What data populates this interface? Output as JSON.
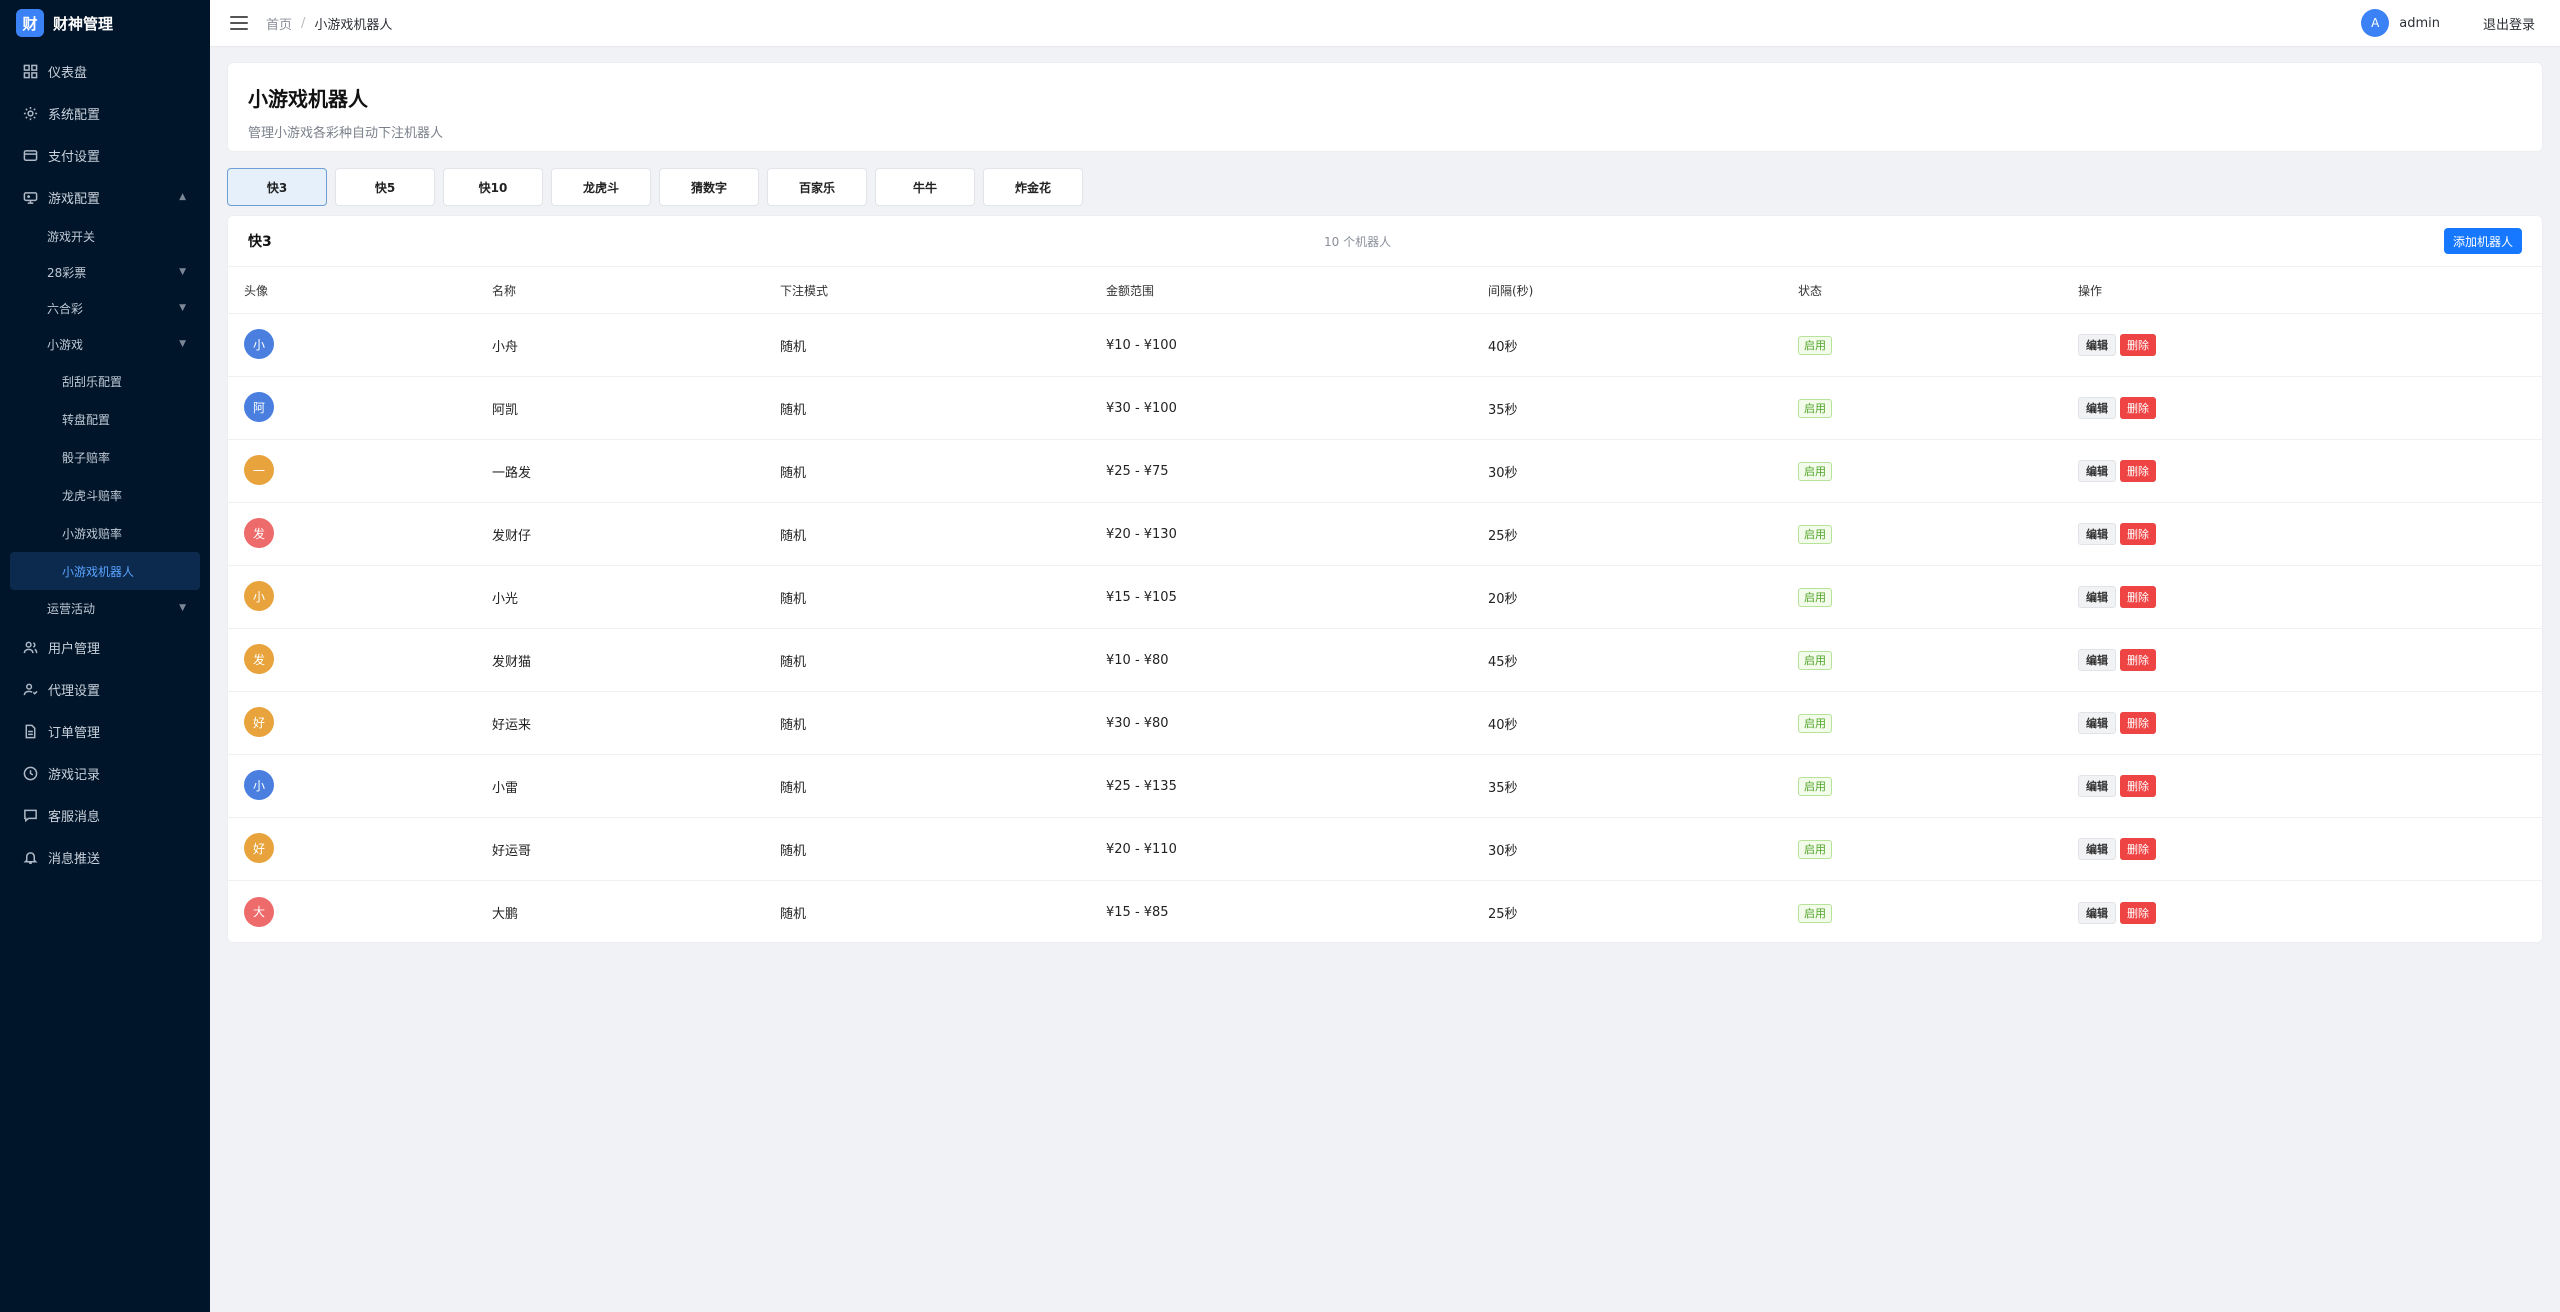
{
  "brand": {
    "logo_char": "财",
    "name": "财神管理"
  },
  "sidebar": {
    "items": [
      {
        "label": "仪表盘",
        "icon": "dashboard-icon"
      },
      {
        "label": "系统配置",
        "icon": "gear-icon"
      },
      {
        "label": "支付设置",
        "icon": "credit-card-icon"
      },
      {
        "label": "游戏配置",
        "icon": "gamepad-icon",
        "arrow": "▲"
      }
    ],
    "game_sub": [
      {
        "label": "游戏开关"
      },
      {
        "label": "28彩票",
        "arrow": "▼"
      },
      {
        "label": "六合彩",
        "arrow": "▼"
      },
      {
        "label": "小游戏",
        "arrow": "▼"
      }
    ],
    "mini_sub": [
      {
        "label": "刮刮乐配置"
      },
      {
        "label": "转盘配置"
      },
      {
        "label": "骰子赔率"
      },
      {
        "label": "龙虎斗赔率"
      },
      {
        "label": "小游戏赔率"
      },
      {
        "label": "小游戏机器人"
      }
    ],
    "promo": {
      "label": "运营活动",
      "arrow": "▼"
    },
    "bottom_items": [
      {
        "label": "用户管理",
        "icon": "users-icon"
      },
      {
        "label": "代理设置",
        "icon": "agent-icon"
      },
      {
        "label": "订单管理",
        "icon": "document-icon"
      },
      {
        "label": "游戏记录",
        "icon": "clock-icon"
      },
      {
        "label": "客服消息",
        "icon": "chat-icon"
      },
      {
        "label": "消息推送",
        "icon": "bell-icon"
      }
    ]
  },
  "header": {
    "breadcrumb_home": "首页",
    "breadcrumb_sep": "/",
    "breadcrumb_current": "小游戏机器人",
    "user_avatar": "A",
    "user_name": "admin",
    "logout": "退出登录"
  },
  "page": {
    "title": "小游戏机器人",
    "subtitle": "管理小游戏各彩种自动下注机器人"
  },
  "tabs": [
    "快3",
    "快5",
    "快10",
    "龙虎斗",
    "猜数字",
    "百家乐",
    "牛牛",
    "炸金花"
  ],
  "table": {
    "title": "快3",
    "count": "10 个机器人",
    "add_button": "添加机器人",
    "columns": [
      "头像",
      "名称",
      "下注模式",
      "金额范围",
      "间隔(秒)",
      "状态",
      "操作"
    ],
    "edit_label": "编辑",
    "delete_label": "删除",
    "rows": [
      {
        "avatar": "小",
        "color": "#4a7fe0",
        "name": "小舟",
        "mode": "随机",
        "range": "¥10 - ¥100",
        "interval": "40秒",
        "status": "启用"
      },
      {
        "avatar": "阿",
        "color": "#4a7fe0",
        "name": "阿凯",
        "mode": "随机",
        "range": "¥30 - ¥100",
        "interval": "35秒",
        "status": "启用"
      },
      {
        "avatar": "一",
        "color": "#e8a33c",
        "name": "一路发",
        "mode": "随机",
        "range": "¥25 - ¥75",
        "interval": "30秒",
        "status": "启用"
      },
      {
        "avatar": "发",
        "color": "#ee6b6b",
        "name": "发财仔",
        "mode": "随机",
        "range": "¥20 - ¥130",
        "interval": "25秒",
        "status": "启用"
      },
      {
        "avatar": "小",
        "color": "#e8a33c",
        "name": "小光",
        "mode": "随机",
        "range": "¥15 - ¥105",
        "interval": "20秒",
        "status": "启用"
      },
      {
        "avatar": "发",
        "color": "#e8a33c",
        "name": "发财猫",
        "mode": "随机",
        "range": "¥10 - ¥80",
        "interval": "45秒",
        "status": "启用"
      },
      {
        "avatar": "好",
        "color": "#e8a33c",
        "name": "好运来",
        "mode": "随机",
        "range": "¥30 - ¥80",
        "interval": "40秒",
        "status": "启用"
      },
      {
        "avatar": "小",
        "color": "#4a7fe0",
        "name": "小雷",
        "mode": "随机",
        "range": "¥25 - ¥135",
        "interval": "35秒",
        "status": "启用"
      },
      {
        "avatar": "好",
        "color": "#e8a33c",
        "name": "好运哥",
        "mode": "随机",
        "range": "¥20 - ¥110",
        "interval": "30秒",
        "status": "启用"
      },
      {
        "avatar": "大",
        "color": "#ee6b6b",
        "name": "大鹏",
        "mode": "随机",
        "range": "¥15 - ¥85",
        "interval": "25秒",
        "status": "启用"
      }
    ]
  }
}
